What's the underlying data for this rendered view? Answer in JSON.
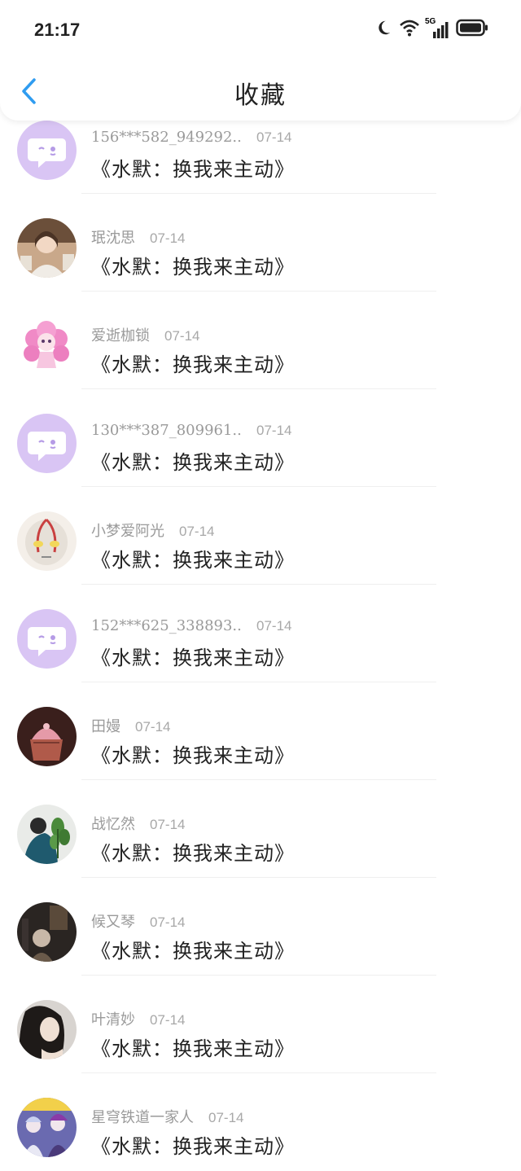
{
  "status_bar": {
    "time": "21:17",
    "network": "5G",
    "icons": [
      "moon-icon",
      "wifi-icon",
      "signal-icon",
      "battery-icon"
    ]
  },
  "nav": {
    "title": "收藏",
    "back_icon": "chevron-left-icon",
    "accent": "#2f9cf0"
  },
  "items": [
    {
      "name": "156***582_949292...",
      "date": "07-14",
      "title": "《水默：换我来主动》",
      "avatar": "default"
    },
    {
      "name": "珉沈思",
      "date": "07-14",
      "title": "《水默：换我来主动》",
      "avatar": "photo-girl"
    },
    {
      "name": "爱逝枷锁",
      "date": "07-14",
      "title": "《水默：换我来主动》",
      "avatar": "pink-doll"
    },
    {
      "name": "130***387_809961...",
      "date": "07-14",
      "title": "《水默：换我来主动》",
      "avatar": "default"
    },
    {
      "name": "小梦爱阿光",
      "date": "07-14",
      "title": "《水默：换我来主动》",
      "avatar": "ultraman"
    },
    {
      "name": "152***625_338893...",
      "date": "07-14",
      "title": "《水默：换我来主动》",
      "avatar": "default"
    },
    {
      "name": "田嫚",
      "date": "07-14",
      "title": "《水默：换我来主动》",
      "avatar": "cupcake"
    },
    {
      "name": "战忆然",
      "date": "07-14",
      "title": "《水默：换我来主动》",
      "avatar": "plant-person"
    },
    {
      "name": "候又琴",
      "date": "07-14",
      "title": "《水默：换我来主动》",
      "avatar": "dark-room"
    },
    {
      "name": "叶清妙",
      "date": "07-14",
      "title": "《水默：换我来主动》",
      "avatar": "portrait"
    },
    {
      "name": "星穹铁道一家人",
      "date": "07-14",
      "title": "《水默：换我来主动》",
      "avatar": "anime-group"
    }
  ]
}
